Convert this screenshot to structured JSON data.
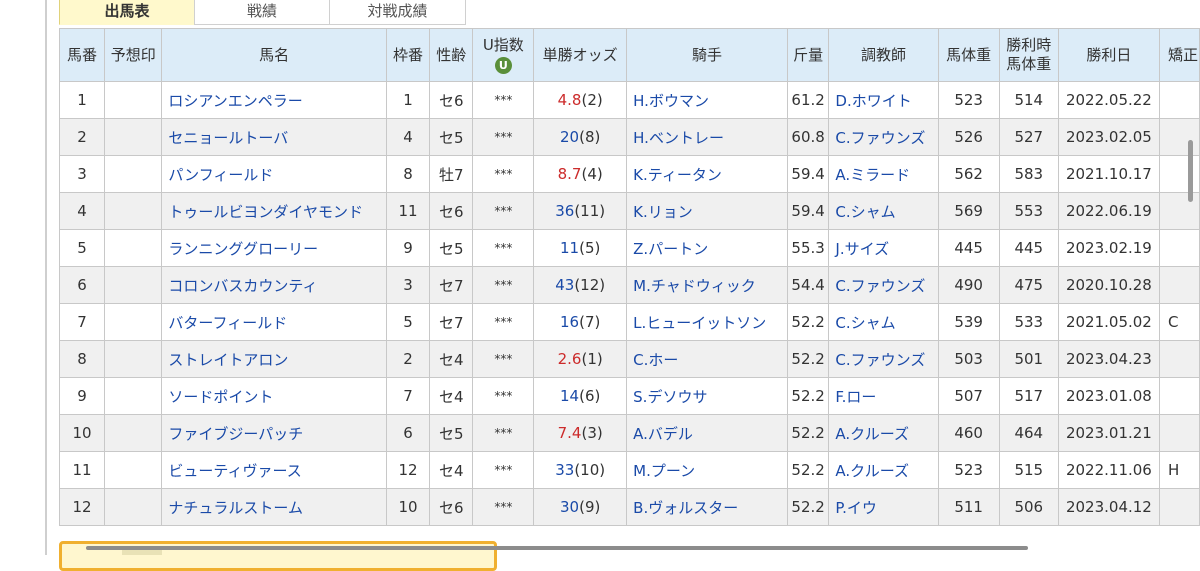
{
  "tabs": [
    {
      "label": "出馬表",
      "active": true
    },
    {
      "label": "戦績",
      "active": false
    },
    {
      "label": "対戦成績",
      "active": false
    }
  ],
  "headers": {
    "umaban": "馬番",
    "yoso": "予想印",
    "bamei": "馬名",
    "wakuban": "枠番",
    "seirei": "性齢",
    "u_index": "U指数",
    "u_badge": "U",
    "odds": "単勝オッズ",
    "jockey": "騎手",
    "kinryo": "斤量",
    "trainer": "調教師",
    "bataiju": "馬体重",
    "win_weight_1": "勝利時",
    "win_weight_2": "馬体重",
    "win_date": "勝利日",
    "extra": "矯正"
  },
  "rows": [
    {
      "no": "1",
      "mark": "",
      "name": "ロシアンエンペラー",
      "waku": "1",
      "sexage": "セ6",
      "uidx": "***",
      "odds": "4.8",
      "rank": "(2)",
      "fav": true,
      "jockey": "H.ボウマン",
      "weight": "61.2",
      "trainer": "D.ホワイト",
      "body": "523",
      "winbody": "514",
      "windate": "2022.05.22",
      "extra": ""
    },
    {
      "no": "2",
      "mark": "",
      "name": "セニョールトーバ",
      "waku": "4",
      "sexage": "セ5",
      "uidx": "***",
      "odds": "20",
      "rank": "(8)",
      "fav": false,
      "jockey": "H.ベントレー",
      "weight": "60.8",
      "trainer": "C.ファウンズ",
      "body": "526",
      "winbody": "527",
      "windate": "2023.02.05",
      "extra": ""
    },
    {
      "no": "3",
      "mark": "",
      "name": "パンフィールド",
      "waku": "8",
      "sexage": "牡7",
      "uidx": "***",
      "odds": "8.7",
      "rank": "(4)",
      "fav": true,
      "jockey": "K.ティータン",
      "weight": "59.4",
      "trainer": "A.ミラード",
      "body": "562",
      "winbody": "583",
      "windate": "2021.10.17",
      "extra": ""
    },
    {
      "no": "4",
      "mark": "",
      "name": "トゥールビヨンダイヤモンド",
      "waku": "11",
      "sexage": "セ6",
      "uidx": "***",
      "odds": "36",
      "rank": "(11)",
      "fav": false,
      "jockey": "K.リョン",
      "weight": "59.4",
      "trainer": "C.シャム",
      "body": "569",
      "winbody": "553",
      "windate": "2022.06.19",
      "extra": ""
    },
    {
      "no": "5",
      "mark": "",
      "name": "ランニンググローリー",
      "waku": "9",
      "sexage": "セ5",
      "uidx": "***",
      "odds": "11",
      "rank": "(5)",
      "fav": false,
      "jockey": "Z.パートン",
      "weight": "55.3",
      "trainer": "J.サイズ",
      "body": "445",
      "winbody": "445",
      "windate": "2023.02.19",
      "extra": ""
    },
    {
      "no": "6",
      "mark": "",
      "name": "コロンバスカウンティ",
      "waku": "3",
      "sexage": "セ7",
      "uidx": "***",
      "odds": "43",
      "rank": "(12)",
      "fav": false,
      "jockey": "M.チャドウィック",
      "weight": "54.4",
      "trainer": "C.ファウンズ",
      "body": "490",
      "winbody": "475",
      "windate": "2020.10.28",
      "extra": ""
    },
    {
      "no": "7",
      "mark": "",
      "name": "バターフィールド",
      "waku": "5",
      "sexage": "セ7",
      "uidx": "***",
      "odds": "16",
      "rank": "(7)",
      "fav": false,
      "jockey": "L.ヒューイットソン",
      "weight": "52.2",
      "trainer": "C.シャム",
      "body": "539",
      "winbody": "533",
      "windate": "2021.05.02",
      "extra": "C"
    },
    {
      "no": "8",
      "mark": "",
      "name": "ストレイトアロン",
      "waku": "2",
      "sexage": "セ4",
      "uidx": "***",
      "odds": "2.6",
      "rank": "(1)",
      "fav": true,
      "jockey": "C.ホー",
      "weight": "52.2",
      "trainer": "C.ファウンズ",
      "body": "503",
      "winbody": "501",
      "windate": "2023.04.23",
      "extra": ""
    },
    {
      "no": "9",
      "mark": "",
      "name": "ソードポイント",
      "waku": "7",
      "sexage": "セ4",
      "uidx": "***",
      "odds": "14",
      "rank": "(6)",
      "fav": false,
      "jockey": "S.デソウサ",
      "weight": "52.2",
      "trainer": "F.ロー",
      "body": "507",
      "winbody": "517",
      "windate": "2023.01.08",
      "extra": ""
    },
    {
      "no": "10",
      "mark": "",
      "name": "ファイブジーパッチ",
      "waku": "6",
      "sexage": "セ5",
      "uidx": "***",
      "odds": "7.4",
      "rank": "(3)",
      "fav": true,
      "jockey": "A.バデル",
      "weight": "52.2",
      "trainer": "A.クルーズ",
      "body": "460",
      "winbody": "464",
      "windate": "2023.01.21",
      "extra": ""
    },
    {
      "no": "11",
      "mark": "",
      "name": "ビューティヴァース",
      "waku": "12",
      "sexage": "セ4",
      "uidx": "***",
      "odds": "33",
      "rank": "(10)",
      "fav": false,
      "jockey": "M.プーン",
      "weight": "52.2",
      "trainer": "A.クルーズ",
      "body": "523",
      "winbody": "515",
      "windate": "2022.11.06",
      "extra": "H"
    },
    {
      "no": "12",
      "mark": "",
      "name": "ナチュラルストーム",
      "waku": "10",
      "sexage": "セ6",
      "uidx": "***",
      "odds": "30",
      "rank": "(9)",
      "fav": false,
      "jockey": "B.ヴォルスター",
      "weight": "52.2",
      "trainer": "P.イウ",
      "body": "511",
      "winbody": "506",
      "windate": "2023.04.12",
      "extra": ""
    }
  ]
}
